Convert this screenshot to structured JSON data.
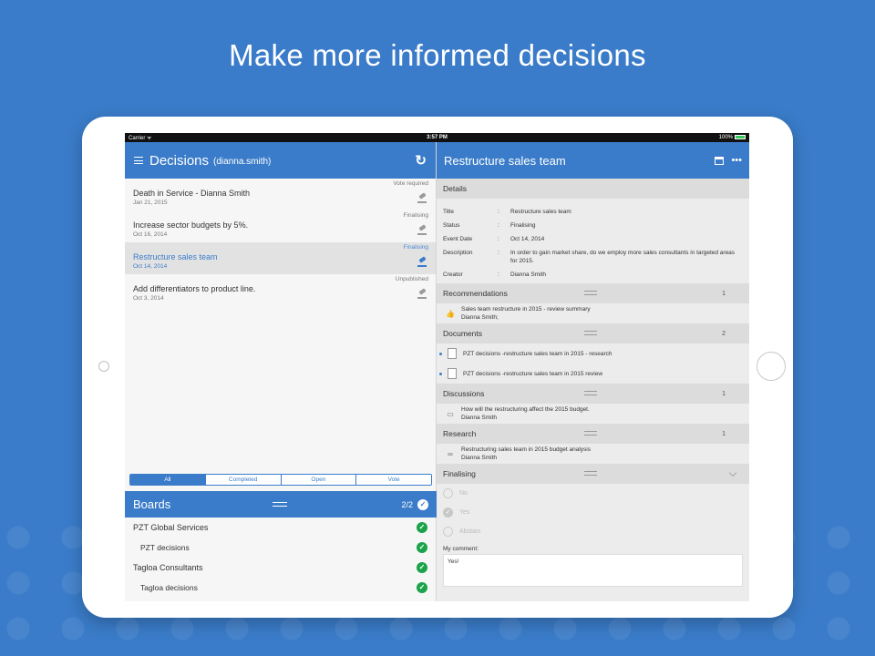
{
  "headline": "Make more informed decisions",
  "status_bar": {
    "carrier": "Carrier ᯤ",
    "time": "3:57 PM",
    "battery": "100%"
  },
  "left": {
    "title": "Decisions",
    "user": "(dianna.smith)",
    "refresh_icon": "refresh-icon",
    "decisions": [
      {
        "status": "Vote required",
        "title": "Death in Service - Dianna Smith",
        "date": "Jan 21, 2015"
      },
      {
        "status": "Finalising",
        "title": "Increase sector budgets by 5%.",
        "date": "Oct 16, 2014"
      },
      {
        "status": "Finalising",
        "title": "Restructure sales team",
        "date": "Oct 14, 2014"
      },
      {
        "status": "Unpublished",
        "title": "Add differentiators to product line.",
        "date": "Oct 3, 2014"
      }
    ],
    "filters": [
      "All",
      "Completed",
      "Open",
      "Vote"
    ],
    "boards": {
      "title": "Boards",
      "count": "2/2",
      "items": [
        {
          "label": "PZT Global Services"
        },
        {
          "label": "PZT decisions"
        },
        {
          "label": "Tagloa Consultants"
        },
        {
          "label": "Tagloa decisions"
        }
      ]
    }
  },
  "right": {
    "title": "Restructure sales team",
    "details": {
      "header": "Details",
      "rows": [
        {
          "k": "Title",
          "v": "Restructure sales team"
        },
        {
          "k": "Status",
          "v": "Finalising"
        },
        {
          "k": "Event Date",
          "v": "Oct 14, 2014"
        },
        {
          "k": "Description",
          "v": "In order to gain market share, do we employ more sales consultants in targeted areas for 2015."
        },
        {
          "k": "Creator",
          "v": "Dianna Smith"
        }
      ]
    },
    "recommendations": {
      "header": "Recommendations",
      "count": "1",
      "item_title": "Sales team restructure in 2015 - review summary",
      "item_sub": "Dianna Smith;"
    },
    "documents": {
      "header": "Documents",
      "count": "2",
      "items": [
        "PZT decisions -restructure sales team in 2015 - research",
        "PZT decisions -restructure sales team in 2015 review"
      ]
    },
    "discussions": {
      "header": "Discussions",
      "count": "1",
      "item_title": "How will the restructuring affect the 2015 budget.",
      "item_sub": "Dianna Smith"
    },
    "research": {
      "header": "Research",
      "count": "1",
      "item_title": "Restructuring sales team in 2015 budget analysis",
      "item_sub": "Dianna Smith"
    },
    "finalising": {
      "header": "Finalising",
      "options": [
        "No",
        "Yes",
        "Abstain"
      ],
      "comment_label": "My comment:",
      "comment_value": "Yes!"
    }
  }
}
